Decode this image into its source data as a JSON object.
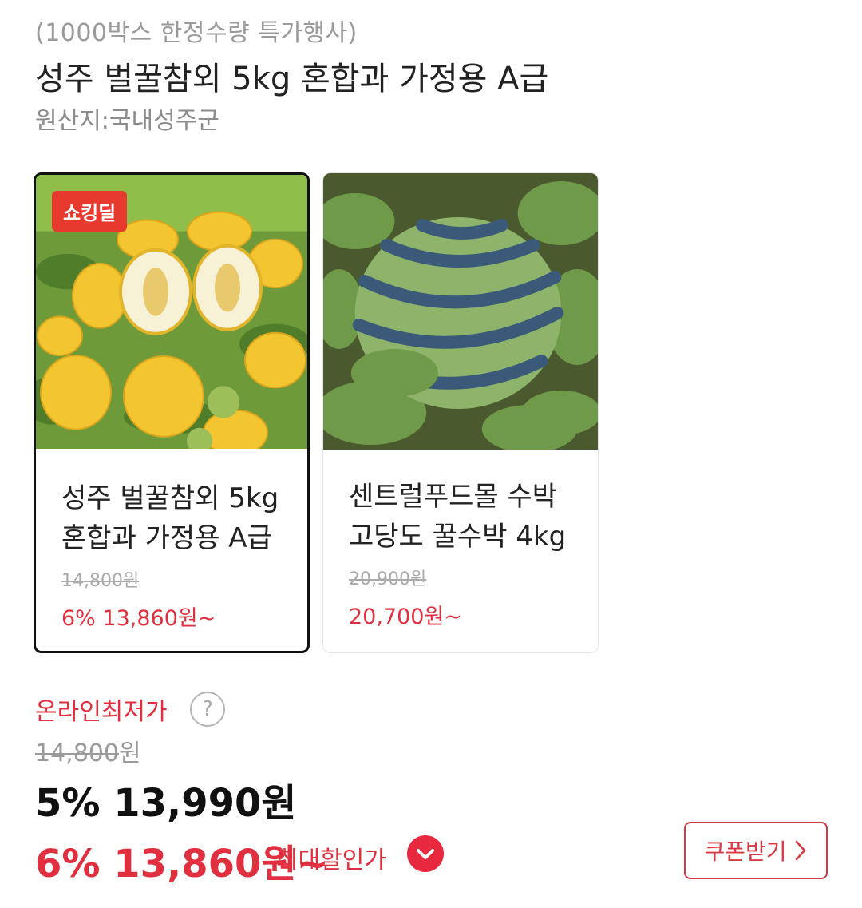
{
  "header": {
    "promo": "(1000박스 한정수량 특가행사)",
    "title": "성주 벌꿀참외 5kg 혼합과 가정용 A급",
    "origin": "원산지:국내성주군"
  },
  "cards": [
    {
      "badge": "쇼킹딜",
      "image": "korean-melon-photo",
      "name_line1": "성주 벌꿀참외 5kg",
      "name_line2": "혼합과 가정용 A급",
      "original_price": "14,800원",
      "sale_price": "6% 13,860원~",
      "selected": true
    },
    {
      "image": "watermelon-photo",
      "name_line1": "센트럴푸드몰 수박",
      "name_line2": "고당도 꿀수박 4kg",
      "original_price": "20,900원",
      "sale_price": "20,700원~",
      "selected": false
    }
  ],
  "pricing": {
    "lowest_label": "온라인최저가",
    "help_icon": "?",
    "original_number": "14,800",
    "original_unit": "원",
    "discount_price": "5% 13,990원",
    "max_discount_price": "6% 13,860원~",
    "max_discount_label": "최대할인가",
    "coupon_label": "쿠폰받기"
  },
  "colors": {
    "accent_red": "#e0303f",
    "badge_red": "#e8392f",
    "muted": "#9a9a9a"
  }
}
